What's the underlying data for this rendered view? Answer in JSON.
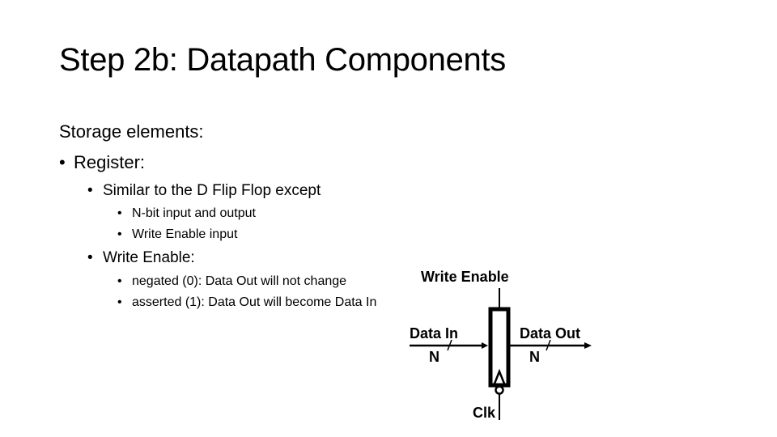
{
  "slide": {
    "title": "Step 2b: Datapath Components",
    "bullets": {
      "heading": "Storage elements:",
      "register": "Register:",
      "similar": "Similar to the D Flip Flop except",
      "nbit": "N-bit input and output",
      "we_input": "Write Enable input",
      "write_enable": "Write Enable:",
      "negated": "negated (0): Data Out will not change",
      "asserted": "asserted (1): Data Out will become Data In"
    },
    "bullet_char": "•"
  },
  "diagram": {
    "write_enable_label": "Write Enable",
    "data_in_label": "Data In",
    "data_out_label": "Data Out",
    "width_in_label": "N",
    "width_out_label": "N",
    "clock_label": "Clk"
  }
}
